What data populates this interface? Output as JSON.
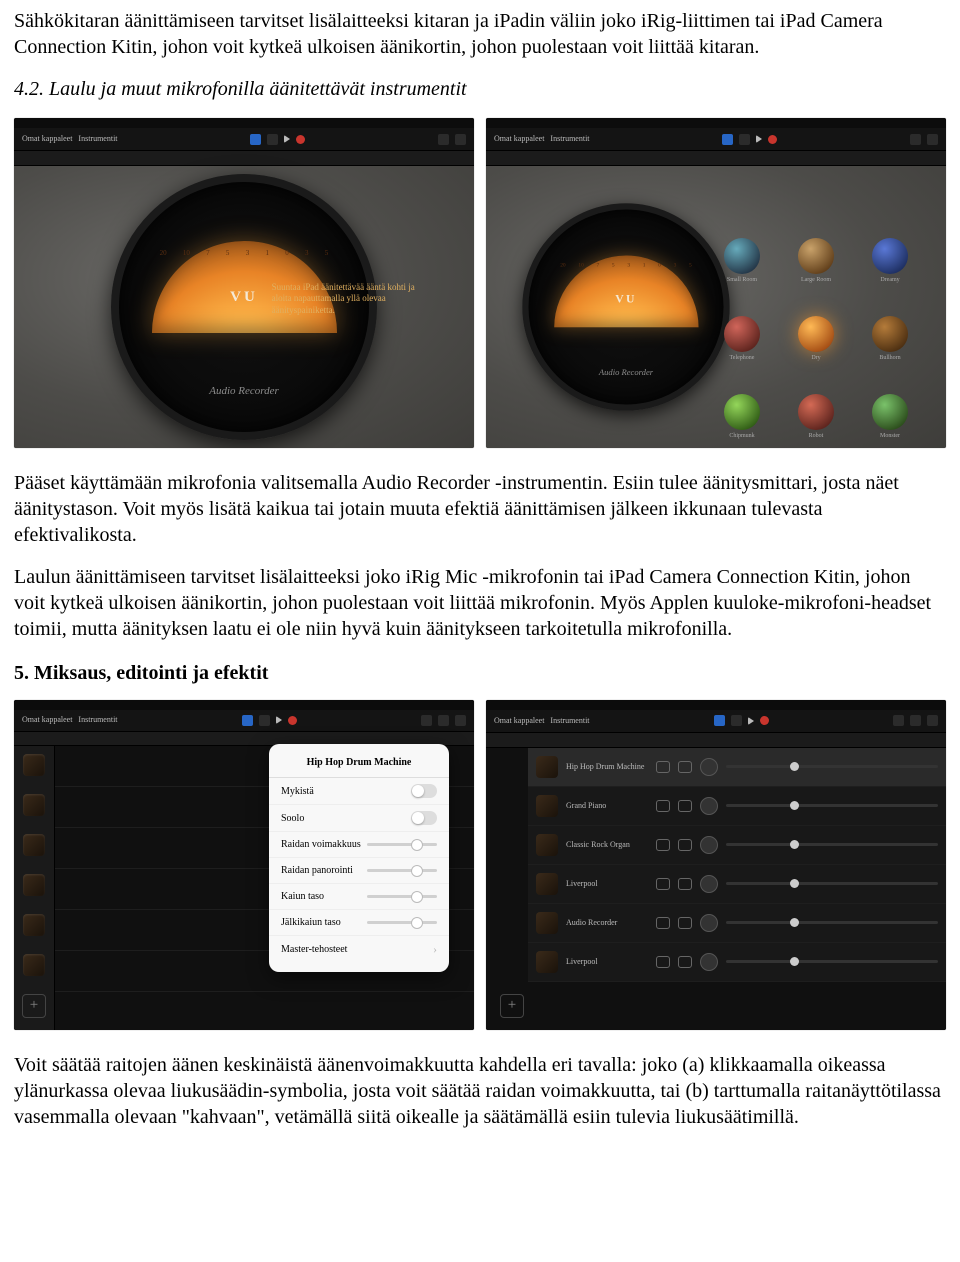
{
  "para1": "Sähkökitaran äänittämiseen tarvitset lisälaitteeksi kitaran ja iPadin väliin joko iRig-liittimen tai iPad Camera Connection Kitin, johon voit kytkeä ulkoisen äänikortin, johon puolestaan voit liittää kitaran.",
  "heading42": "4.2. Laulu ja muut mikrofonilla äänitettävät instrumentit",
  "vu": {
    "scale": [
      "20",
      "10",
      "7",
      "5",
      "3",
      "1",
      "0",
      "3",
      "5"
    ],
    "label": "VU",
    "script": "Audio Recorder",
    "tip": "Suuntaa iPad äänitettävää ääntä kohti ja aloita napauttamalla yllä olevaa äänityspainiketta."
  },
  "rgrid": [
    "Small Room",
    "Large Room",
    "Dreamy",
    "Telephone",
    "Dry",
    "Bullhorn",
    "Chipmunk",
    "Robot",
    "Monster"
  ],
  "toolbar": {
    "left1": "Omat kappaleet",
    "left2": "Instrumentit"
  },
  "para2": "Pääset käyttämään mikrofonia valitsemalla Audio Recorder -instrumentin. Esiin tulee äänitysmittari, josta näet äänitystason. Voit myös lisätä kaikua tai jotain muuta efektiä äänittämisen jälkeen ikkunaan tulevasta efektivalikosta.",
  "para3": "Laulun äänittämiseen tarvitset lisälaitteeksi joko iRig Mic -mikrofonin tai iPad Camera Connection Kitin, johon voit kytkeä ulkoisen äänikortin, johon puolestaan voit liittää mikrofonin. Myös Applen kuuloke-mikrofoni-headset toimii, mutta äänityksen laatu ei ole niin hyvä kuin äänitykseen tarkoitetulla mikrofonilla.",
  "heading5": "5. Miksaus, editointi ja efektit",
  "popup": {
    "title": "Hip Hop Drum Machine",
    "rows": [
      {
        "label": "Mykistä",
        "type": "toggle"
      },
      {
        "label": "Soolo",
        "type": "toggle"
      },
      {
        "label": "Raidan voimakkuus",
        "type": "slider"
      },
      {
        "label": "Raidan panorointi",
        "type": "slider"
      },
      {
        "label": "Kaiun taso",
        "type": "slider"
      },
      {
        "label": "Jälkikaiun taso",
        "type": "slider"
      },
      {
        "label": "Master-tehosteet",
        "type": "chev"
      }
    ]
  },
  "mixer": [
    "Hip Hop Drum Machine",
    "Grand Piano",
    "Classic Rock Organ",
    "Liverpool",
    "Audio Recorder",
    "Liverpool"
  ],
  "para4": "Voit säätää raitojen äänen keskinäistä äänenvoimakkuutta kahdella eri tavalla: joko (a) klikkaamalla oikeassa ylänurkassa olevaa liukusäädin-symbolia, josta voit säätää raidan voimakkuutta, tai (b) tarttumalla raitanäyttötilassa vasemmalla olevaan \"kahvaan\", vetämällä siitä oikealle ja säätämällä esiin tulevia liukusäätimillä."
}
